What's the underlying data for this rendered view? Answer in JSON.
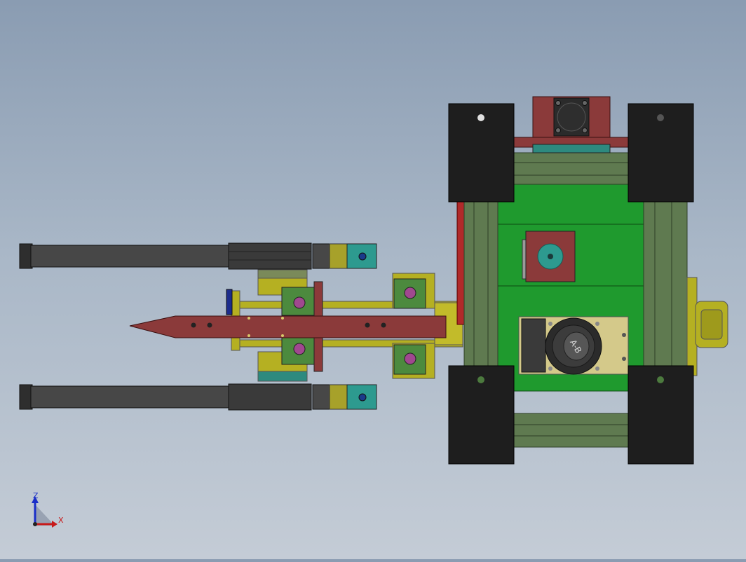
{
  "view": {
    "background_top": "#8a9cb2",
    "background_bottom": "#c4ccd6"
  },
  "colors": {
    "frame_green": "#5f7a50",
    "frame_green_dark": "#3e5234",
    "plate_green": "#1f9a2e",
    "wheel_black": "#1e1e1e",
    "maroon": "#8b3a3a",
    "yellow_olive": "#b5b022",
    "teal_block": "#2d9a8f",
    "rod_gray": "#444444",
    "bolt_magenta": "#a0488f",
    "axis_blue": "#1a2ec8",
    "axis_red": "#c81a1a"
  },
  "motor": {
    "brand": "A-B"
  },
  "triad": {
    "z_label": "Z",
    "x_label": "X"
  }
}
